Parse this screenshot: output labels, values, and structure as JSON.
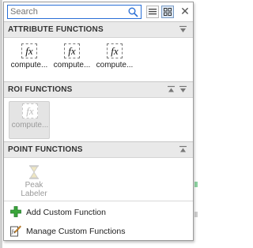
{
  "search": {
    "placeholder": "Search"
  },
  "toolbar": {
    "list_view_icon": "list-icon",
    "grid_view_icon": "grid-icon",
    "close_label": "✕"
  },
  "sections": [
    {
      "title": "ATTRIBUTE FUNCTIONS",
      "items": [
        {
          "label": "compute...",
          "icon": "fx-icon",
          "enabled": true
        },
        {
          "label": "compute...",
          "icon": "fx-icon",
          "enabled": true
        },
        {
          "label": "compute...",
          "icon": "fx-icon",
          "enabled": true
        }
      ]
    },
    {
      "title": "ROI FUNCTIONS",
      "items": [
        {
          "label": "compute...",
          "icon": "fx-icon",
          "enabled": false
        }
      ]
    },
    {
      "title": "POINT FUNCTIONS",
      "items": [
        {
          "label": "Peak Labeler",
          "label_line1": "Peak",
          "label_line2": "Labeler",
          "icon": "hourglass-icon",
          "enabled": false
        }
      ]
    }
  ],
  "actions": [
    {
      "label": "Add Custom Function",
      "icon": "green-plus-icon"
    },
    {
      "label": "Manage Custom Functions",
      "icon": "manage-edit-icon"
    }
  ],
  "fx_glyph": "fx",
  "colors": {
    "accent": "#2a6fd6",
    "header_bg": "#e9e9e9",
    "add_icon": "#3aa63a"
  }
}
